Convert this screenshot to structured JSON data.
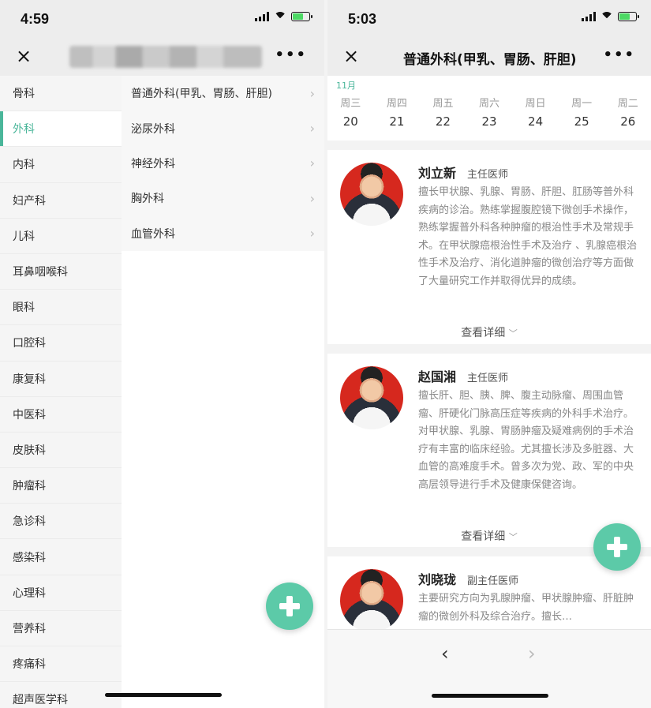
{
  "left": {
    "status": {
      "time": "4:59"
    },
    "nav": {
      "close": "×",
      "more": "•••"
    },
    "departments": [
      "骨科",
      "外科",
      "内科",
      "妇产科",
      "儿科",
      "耳鼻咽喉科",
      "眼科",
      "口腔科",
      "康复科",
      "中医科",
      "皮肤科",
      "肿瘤科",
      "急诊科",
      "感染科",
      "心理科",
      "营养科",
      "疼痛科",
      "超声医学科"
    ],
    "selected_department": "外科",
    "subdepartments": [
      "普通外科(甲乳、胃肠、肝胆)",
      "泌尿外科",
      "神经外科",
      "胸外科",
      "血管外科"
    ],
    "chevron": "›",
    "fab_icon": "plus-icon"
  },
  "right": {
    "status": {
      "time": "5:03"
    },
    "nav": {
      "close": "×",
      "title": "普通外科(甲乳、胃肠、肝胆)",
      "more": "•••"
    },
    "calendar": {
      "month": "11月",
      "days": [
        {
          "weekday": "周三",
          "date": "20"
        },
        {
          "weekday": "周四",
          "date": "21"
        },
        {
          "weekday": "周五",
          "date": "22"
        },
        {
          "weekday": "周六",
          "date": "23"
        },
        {
          "weekday": "周日",
          "date": "24"
        },
        {
          "weekday": "周一",
          "date": "25"
        },
        {
          "weekday": "周二",
          "date": "26"
        }
      ]
    },
    "doctors": [
      {
        "name": "刘立新",
        "rank": "主任医师",
        "desc": "擅长甲状腺、乳腺、胃肠、肝胆、肛肠等普外科疾病的诊治。熟练掌握腹腔镜下微创手术操作，熟练掌握普外科各种肿瘤的根治性手术及常规手术。在甲状腺癌根治性手术及治疗 、乳腺癌根治性手术及治疗、消化道肿瘤的微创治疗等方面做了大量研究工作并取得优异的成绩。",
        "detail": "查看详细"
      },
      {
        "name": "赵国湘",
        "rank": "主任医师",
        "desc": "擅长肝、胆、胰、脾、腹主动脉瘤、周围血管瘤、肝硬化门脉高压症等疾病的外科手术治疗。对甲状腺、乳腺、胃肠肿瘤及疑难病例的手术治疗有丰富的临床经验。尤其擅长涉及多脏器、大血管的高难度手术。曾多次为党、政、军的中央高层领导进行手术及健康保健咨询。",
        "detail": "查看详细"
      },
      {
        "name": "刘晓珑",
        "rank": "副主任医师",
        "desc": "主要研究方向为乳腺肿瘤、甲状腺肿瘤、肝脏肿瘤的微创外科及综合治疗。擅长…",
        "detail": ""
      }
    ],
    "detail_arrow": "﹀",
    "bottom": {
      "back": "‹",
      "forward": "›"
    },
    "fab_icon": "plus-icon"
  }
}
